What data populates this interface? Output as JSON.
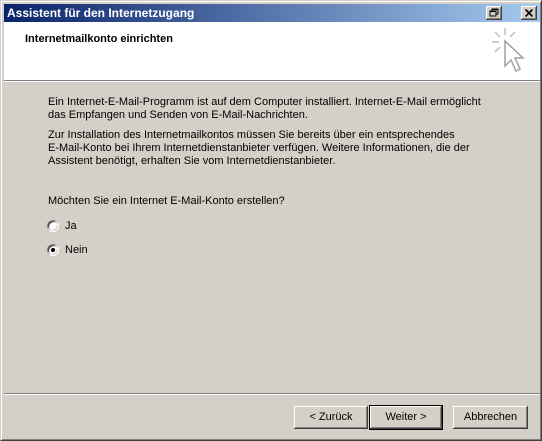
{
  "window": {
    "title": "Assistent für den Internetzugang"
  },
  "header": {
    "title": "Internetmailkonto einrichten"
  },
  "body": {
    "paragraph1_line1": "Ein Internet-E-Mail-Programm ist auf dem Computer installiert. Internet-E-Mail ermöglicht",
    "paragraph1_line2": "das Empfangen und Senden von E-Mail-Nachrichten.",
    "paragraph2_line1": "Zur Installation des Internetmailkontos müssen Sie bereits über ein entsprechendes",
    "paragraph2_line2": "E-Mail-Konto bei Ihrem Internetdienstanbieter verfügen. Weitere Informationen, die der",
    "paragraph2_line3": "Assistent benötigt, erhalten Sie vom Internetdienstanbieter.",
    "question": "Möchten Sie ein Internet E-Mail-Konto erstellen?",
    "options": [
      {
        "label": "Ja",
        "selected": false
      },
      {
        "label": "Nein",
        "selected": true
      }
    ]
  },
  "buttons": {
    "back": "< Zurück",
    "next": "Weiter >",
    "cancel": "Abbrechen"
  },
  "icons": {
    "restore": "restore-icon",
    "close": "close-icon",
    "wizard": "cursor-sparkle-icon"
  }
}
